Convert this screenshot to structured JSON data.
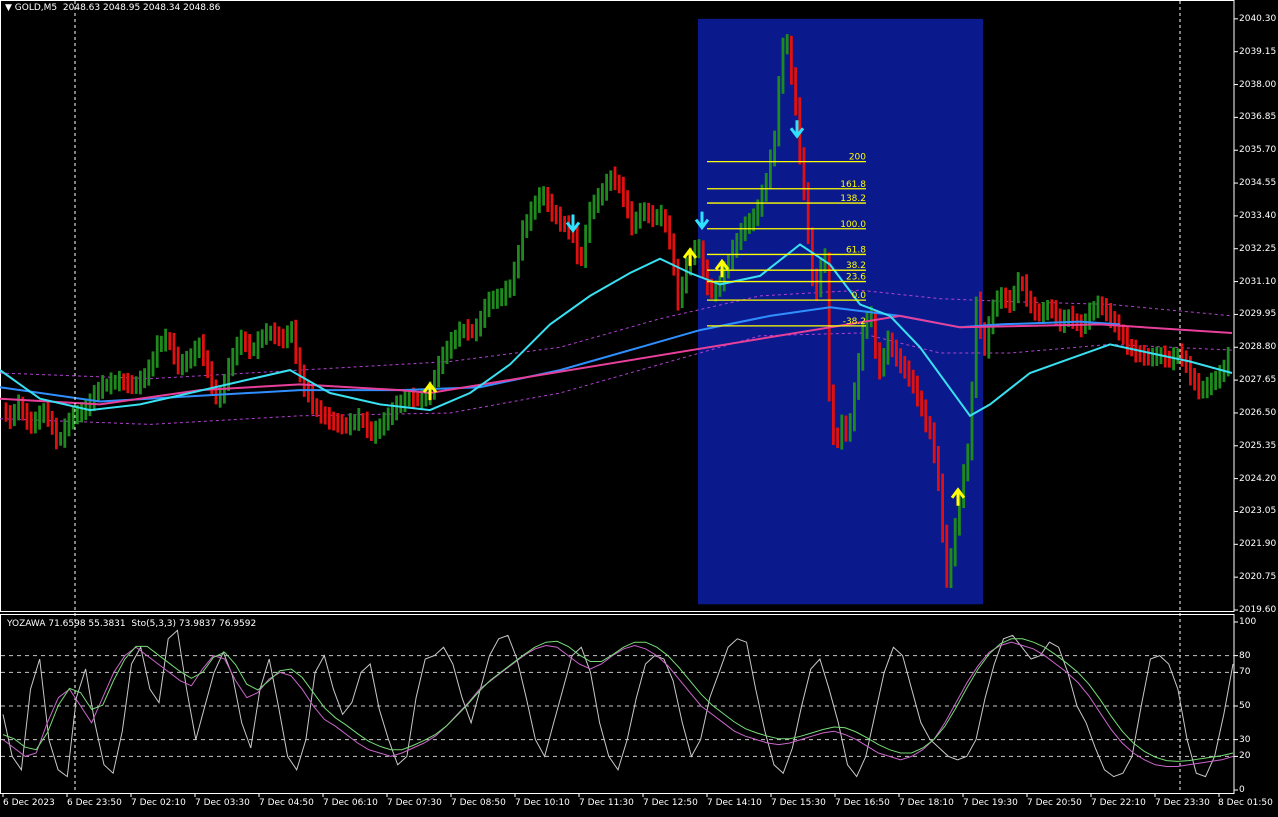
{
  "header": {
    "symbol": "GOLD,M5",
    "ohlc": "2048.63 2048.95 2048.34 2048.86"
  },
  "indicator_header": {
    "yozawa": "YOZAWA 71.6598 55.3831",
    "stoch": "Sto(5,3,3) 73.9837 76.9592"
  },
  "colors": {
    "background": "#000000",
    "bull_candle": "#1e8a1e",
    "bear_candle": "#e01010",
    "box": "#0a1a8c",
    "fib": "#ffff00",
    "ma_fast": "#38e0f0",
    "ma_slow": "#2f8fff",
    "ma_pink": "#e8409a",
    "envelope": "#b040d0",
    "arrow_up": "#ffff00",
    "arrow_down": "#30e0ff",
    "stoch_main": "#c8c8c8",
    "stoch_signal": "#cc66cc",
    "stoch_green": "#77dd77"
  },
  "chart_data": [
    {
      "type": "candlestick",
      "symbol": "GOLD",
      "timeframe": "M5",
      "ylim": [
        2019.6,
        2040.4
      ],
      "y_ticks": [
        "2040.30",
        "2039.15",
        "2038.00",
        "2036.85",
        "2035.70",
        "2034.55",
        "2033.40",
        "2032.25",
        "2031.10",
        "2029.95",
        "2028.80",
        "2027.65",
        "2026.50",
        "2025.35",
        "2024.20",
        "2023.05",
        "2021.90",
        "2020.75",
        "2019.60"
      ],
      "y_tick_values": [
        2040.3,
        2039.15,
        2038.0,
        2036.85,
        2035.7,
        2034.55,
        2033.4,
        2032.25,
        2031.1,
        2029.95,
        2028.8,
        2027.65,
        2026.5,
        2025.35,
        2024.2,
        2023.05,
        2021.9,
        2020.75,
        2019.6
      ],
      "x_ticks": [
        "6 Dec 2023",
        "6 Dec 23:50",
        "7 Dec 02:10",
        "7 Dec 03:30",
        "7 Dec 04:50",
        "7 Dec 06:10",
        "7 Dec 07:30",
        "7 Dec 08:50",
        "7 Dec 10:10",
        "7 Dec 11:30",
        "7 Dec 12:50",
        "7 Dec 14:10",
        "7 Dec 15:30",
        "7 Dec 16:50",
        "7 Dec 18:10",
        "7 Dec 19:30",
        "7 Dec 20:50",
        "7 Dec 22:10",
        "7 Dec 23:30",
        "8 Dec 01:50"
      ],
      "price_path": [
        [
          0,
          2027.2
        ],
        [
          8,
          2026.1
        ],
        [
          18,
          2026.8
        ],
        [
          30,
          2026.0
        ],
        [
          45,
          2026.6
        ],
        [
          58,
          2025.4
        ],
        [
          70,
          2026.3
        ],
        [
          85,
          2026.6
        ],
        [
          100,
          2027.4
        ],
        [
          118,
          2027.6
        ],
        [
          135,
          2027.4
        ],
        [
          148,
          2027.9
        ],
        [
          158,
          2028.9
        ],
        [
          168,
          2029.1
        ],
        [
          178,
          2028.1
        ],
        [
          190,
          2028.4
        ],
        [
          200,
          2028.9
        ],
        [
          210,
          2027.6
        ],
        [
          218,
          2026.8
        ],
        [
          228,
          2028.0
        ],
        [
          240,
          2029.1
        ],
        [
          252,
          2028.6
        ],
        [
          262,
          2029.2
        ],
        [
          272,
          2029.3
        ],
        [
          282,
          2029.0
        ],
        [
          292,
          2029.4
        ],
        [
          298,
          2028.0
        ],
        [
          305,
          2027.3
        ],
        [
          315,
          2026.6
        ],
        [
          330,
          2026.2
        ],
        [
          345,
          2026.0
        ],
        [
          360,
          2026.3
        ],
        [
          372,
          2025.7
        ],
        [
          385,
          2026.2
        ],
        [
          398,
          2026.8
        ],
        [
          410,
          2027.0
        ],
        [
          420,
          2026.9
        ],
        [
          430,
          2027.2
        ],
        [
          440,
          2028.3
        ],
        [
          452,
          2029.0
        ],
        [
          462,
          2029.4
        ],
        [
          475,
          2029.3
        ],
        [
          488,
          2030.4
        ],
        [
          500,
          2030.5
        ],
        [
          512,
          2031.0
        ],
        [
          522,
          2032.8
        ],
        [
          532,
          2033.6
        ],
        [
          542,
          2034.2
        ],
        [
          552,
          2033.5
        ],
        [
          562,
          2033.1
        ],
        [
          572,
          2032.8
        ],
        [
          580,
          2031.6
        ],
        [
          590,
          2033.6
        ],
        [
          600,
          2034.1
        ],
        [
          612,
          2034.8
        ],
        [
          622,
          2034.2
        ],
        [
          632,
          2033.0
        ],
        [
          642,
          2033.6
        ],
        [
          652,
          2033.3
        ],
        [
          662,
          2033.4
        ],
        [
          670,
          2032.5
        ],
        [
          678,
          2030.4
        ],
        [
          688,
          2031.8
        ],
        [
          698,
          2032.4
        ],
        [
          706,
          2031.0
        ],
        [
          714,
          2030.6
        ],
        [
          724,
          2031.4
        ],
        [
          734,
          2032.3
        ],
        [
          744,
          2033.0
        ],
        [
          754,
          2033.3
        ],
        [
          764,
          2034.3
        ],
        [
          774,
          2035.9
        ],
        [
          780,
          2038.4
        ],
        [
          785,
          2040.0
        ],
        [
          790,
          2038.6
        ],
        [
          796,
          2037.1
        ],
        [
          800,
          2035.4
        ],
        [
          806,
          2033.6
        ],
        [
          812,
          2031.2
        ],
        [
          818,
          2030.6
        ],
        [
          824,
          2033.0
        ],
        [
          830,
          2026.2
        ],
        [
          836,
          2025.3
        ],
        [
          842,
          2026.1
        ],
        [
          848,
          2025.6
        ],
        [
          856,
          2027.6
        ],
        [
          862,
          2029.2
        ],
        [
          870,
          2030.2
        ],
        [
          878,
          2027.8
        ],
        [
          888,
          2029.0
        ],
        [
          898,
          2028.3
        ],
        [
          908,
          2027.8
        ],
        [
          916,
          2027.2
        ],
        [
          924,
          2026.3
        ],
        [
          932,
          2025.6
        ],
        [
          940,
          2023.6
        ],
        [
          946,
          2020.5
        ],
        [
          952,
          2021.6
        ],
        [
          958,
          2023.2
        ],
        [
          964,
          2024.4
        ],
        [
          970,
          2025.6
        ],
        [
          976,
          2030.4
        ],
        [
          984,
          2028.6
        ],
        [
          992,
          2030.1
        ],
        [
          1000,
          2030.6
        ],
        [
          1010,
          2030.3
        ],
        [
          1020,
          2031.2
        ],
        [
          1030,
          2030.2
        ],
        [
          1040,
          2029.9
        ],
        [
          1050,
          2030.2
        ],
        [
          1060,
          2029.6
        ],
        [
          1070,
          2029.9
        ],
        [
          1080,
          2029.4
        ],
        [
          1090,
          2030.0
        ],
        [
          1100,
          2030.3
        ],
        [
          1110,
          2029.8
        ],
        [
          1120,
          2029.3
        ],
        [
          1130,
          2028.7
        ],
        [
          1140,
          2028.5
        ],
        [
          1150,
          2028.4
        ],
        [
          1160,
          2028.5
        ],
        [
          1170,
          2028.3
        ],
        [
          1180,
          2028.6
        ],
        [
          1190,
          2027.8
        ],
        [
          1200,
          2027.2
        ],
        [
          1210,
          2027.5
        ],
        [
          1220,
          2027.8
        ],
        [
          1232,
          2028.7
        ]
      ],
      "ma_fast": [
        [
          0,
          2028.0
        ],
        [
          40,
          2027.0
        ],
        [
          90,
          2026.6
        ],
        [
          140,
          2026.8
        ],
        [
          190,
          2027.2
        ],
        [
          240,
          2027.6
        ],
        [
          290,
          2028.0
        ],
        [
          330,
          2027.2
        ],
        [
          380,
          2026.8
        ],
        [
          430,
          2026.6
        ],
        [
          470,
          2027.2
        ],
        [
          510,
          2028.2
        ],
        [
          550,
          2029.6
        ],
        [
          590,
          2030.6
        ],
        [
          630,
          2031.4
        ],
        [
          660,
          2031.9
        ],
        [
          690,
          2031.4
        ],
        [
          720,
          2031.0
        ],
        [
          760,
          2031.3
        ],
        [
          800,
          2032.4
        ],
        [
          830,
          2031.7
        ],
        [
          860,
          2030.3
        ],
        [
          890,
          2029.9
        ],
        [
          920,
          2028.8
        ],
        [
          945,
          2027.6
        ],
        [
          970,
          2026.4
        ],
        [
          990,
          2026.8
        ],
        [
          1030,
          2027.9
        ],
        [
          1070,
          2028.4
        ],
        [
          1110,
          2028.9
        ],
        [
          1150,
          2028.6
        ],
        [
          1190,
          2028.3
        ],
        [
          1232,
          2027.9
        ]
      ],
      "ma_slow": [
        [
          0,
          2027.4
        ],
        [
          100,
          2026.9
        ],
        [
          200,
          2027.1
        ],
        [
          300,
          2027.3
        ],
        [
          400,
          2027.3
        ],
        [
          480,
          2027.4
        ],
        [
          560,
          2028.0
        ],
        [
          640,
          2028.8
        ],
        [
          700,
          2029.4
        ],
        [
          770,
          2029.9
        ],
        [
          830,
          2030.2
        ],
        [
          900,
          2029.9
        ],
        [
          960,
          2029.5
        ],
        [
          1000,
          2029.6
        ],
        [
          1080,
          2029.7
        ],
        [
          1120,
          2029.6
        ]
      ],
      "ma_pink": [
        [
          0,
          2027.0
        ],
        [
          100,
          2026.8
        ],
        [
          200,
          2027.3
        ],
        [
          300,
          2027.5
        ],
        [
          400,
          2027.3
        ],
        [
          430,
          2027.2
        ],
        [
          900,
          2029.9
        ],
        [
          960,
          2029.5
        ],
        [
          1100,
          2029.6
        ],
        [
          1232,
          2029.3
        ]
      ],
      "envelope_upper": [
        [
          0,
          2027.9
        ],
        [
          150,
          2027.7
        ],
        [
          300,
          2028.0
        ],
        [
          450,
          2028.3
        ],
        [
          560,
          2028.8
        ],
        [
          660,
          2029.8
        ],
        [
          760,
          2030.6
        ],
        [
          860,
          2030.8
        ],
        [
          940,
          2030.5
        ],
        [
          1010,
          2030.4
        ],
        [
          1110,
          2030.3
        ],
        [
          1232,
          2029.9
        ]
      ],
      "envelope_lower": [
        [
          0,
          2026.3
        ],
        [
          150,
          2026.1
        ],
        [
          300,
          2026.4
        ],
        [
          450,
          2026.5
        ],
        [
          560,
          2027.2
        ],
        [
          660,
          2028.2
        ],
        [
          760,
          2029.2
        ],
        [
          860,
          2029.3
        ],
        [
          940,
          2028.6
        ],
        [
          1010,
          2028.6
        ],
        [
          1110,
          2028.9
        ],
        [
          1232,
          2028.7
        ]
      ],
      "highlight_box": {
        "x_from": 698,
        "x_to": 983,
        "y_from": 2040.3,
        "y_to": 2019.8
      },
      "fibonacci": [
        {
          "label": "200",
          "price": 2035.3
        },
        {
          "label": "161.8",
          "price": 2034.35
        },
        {
          "label": "138.2",
          "price": 2033.85
        },
        {
          "label": "100.0",
          "price": 2032.95
        },
        {
          "label": "61.8",
          "price": 2032.05
        },
        {
          "label": "38.2",
          "price": 2031.5
        },
        {
          "label": "23.6",
          "price": 2031.1
        },
        {
          "label": "0.0",
          "price": 2030.45
        },
        {
          "label": "-38.2",
          "price": 2029.55
        }
      ],
      "arrows": [
        {
          "dir": "up",
          "x": 430,
          "price": 2027.3
        },
        {
          "dir": "down",
          "x": 573,
          "price": 2033.1
        },
        {
          "dir": "up",
          "x": 690,
          "price": 2032.0
        },
        {
          "dir": "down",
          "x": 702,
          "price": 2033.2
        },
        {
          "dir": "up",
          "x": 722,
          "price": 2031.6
        },
        {
          "dir": "down",
          "x": 797,
          "price": 2036.4
        },
        {
          "dir": "up",
          "x": 958,
          "price": 2023.6
        }
      ],
      "crosshair_x": [
        75,
        1180
      ]
    },
    {
      "type": "line",
      "name": "Sto(5,3,3)",
      "ylim": [
        0,
        100
      ],
      "y_ticks": [
        "100",
        "80",
        "70",
        "50",
        "30",
        "20",
        "0"
      ],
      "y_tick_values": [
        100,
        80,
        70,
        50,
        30,
        20,
        0
      ],
      "series": [
        {
          "name": "main",
          "values": [
            45,
            20,
            12,
            60,
            78,
            30,
            12,
            8,
            55,
            72,
            40,
            15,
            10,
            35,
            75,
            85,
            60,
            52,
            90,
            95,
            60,
            30,
            50,
            70,
            82,
            68,
            40,
            25,
            60,
            78,
            50,
            20,
            12,
            30,
            70,
            80,
            60,
            45,
            52,
            70,
            75,
            48,
            30,
            15,
            20,
            55,
            78,
            80,
            85,
            75,
            55,
            40,
            60,
            80,
            90,
            92,
            78,
            55,
            30,
            20,
            40,
            60,
            80,
            85,
            70,
            40,
            20,
            12,
            30,
            55,
            75,
            80,
            78,
            65,
            40,
            20,
            30,
            55,
            70,
            85,
            90,
            88,
            60,
            35,
            15,
            10,
            25,
            50,
            72,
            78,
            60,
            40,
            15,
            8,
            20,
            45,
            70,
            85,
            80,
            60,
            40,
            30,
            25,
            20,
            18,
            20,
            30,
            55,
            75,
            90,
            92,
            85,
            78,
            80,
            88,
            85,
            70,
            50,
            40,
            25,
            12,
            8,
            10,
            20,
            50,
            78,
            80,
            75,
            60,
            30,
            10,
            8,
            20,
            45,
            75
          ]
        },
        {
          "name": "signal",
          "values": [
            30,
            25,
            20,
            22,
            40,
            55,
            60,
            50,
            40,
            55,
            70,
            80,
            85,
            80,
            75,
            70,
            65,
            62,
            72,
            80,
            78,
            65,
            55,
            58,
            66,
            70,
            68,
            60,
            50,
            42,
            38,
            33,
            28,
            24,
            22,
            20,
            22,
            25,
            28,
            32,
            38,
            45,
            52,
            60,
            65,
            70,
            75,
            80,
            84,
            86,
            85,
            80,
            75,
            72,
            75,
            80,
            84,
            86,
            84,
            80,
            74,
            66,
            58,
            50,
            45,
            40,
            35,
            32,
            30,
            28,
            27,
            28,
            30,
            32,
            34,
            35,
            33,
            30,
            26,
            22,
            20,
            18,
            20,
            24,
            30,
            40,
            52,
            64,
            74,
            82,
            86,
            88,
            86,
            84,
            80,
            75,
            70,
            64,
            56,
            46,
            36,
            28,
            22,
            18,
            15,
            14,
            14,
            15,
            16,
            17,
            18,
            20
          ]
        }
      ]
    }
  ]
}
